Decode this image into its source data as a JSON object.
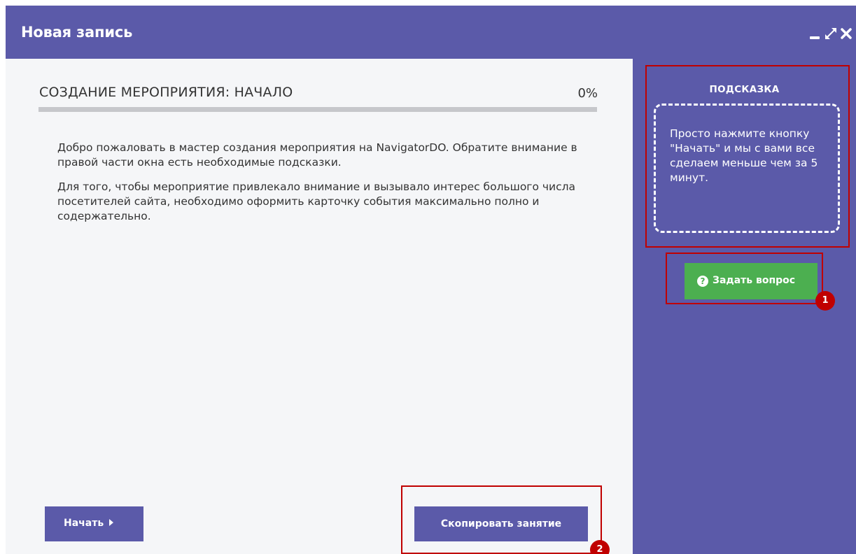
{
  "window": {
    "title": "Новая запись",
    "controls": [
      "minimize-icon",
      "expand-icon",
      "close-icon"
    ]
  },
  "wizard": {
    "step_title": "СОЗДАНИЕ МЕРОПРИЯТИЯ: НАЧАЛО",
    "progress_text": "0%",
    "progress": 0,
    "paragraphs": [
      "Добро пожаловать в мастер создания мероприятия на NavigatorDO. Обратите внимание в правой части окна есть необходимые подсказки.",
      "Для того, чтобы мероприятие привлекало внимание и вызывало интерес большого числа посетителей сайта, необходимо оформить карточку события максимально полно и содержательно."
    ],
    "start_button": "Начать",
    "copy_button": "Скопировать занятие"
  },
  "hint": {
    "title": "ПОДСКАЗКА",
    "text": "Просто нажмите кнопку \"Начать\" и мы с вами все сделаем меньше чем за 5 минут.",
    "ask_button": "Задать вопрос",
    "ask_icon": "question-circle-icon"
  },
  "annotations": {
    "badge_1": "1",
    "badge_2": "2"
  },
  "colors": {
    "primary": "#5b5aa9",
    "accent_green": "#4caf50",
    "annotation_red": "#c00000",
    "content_bg": "#f5f6f8"
  }
}
